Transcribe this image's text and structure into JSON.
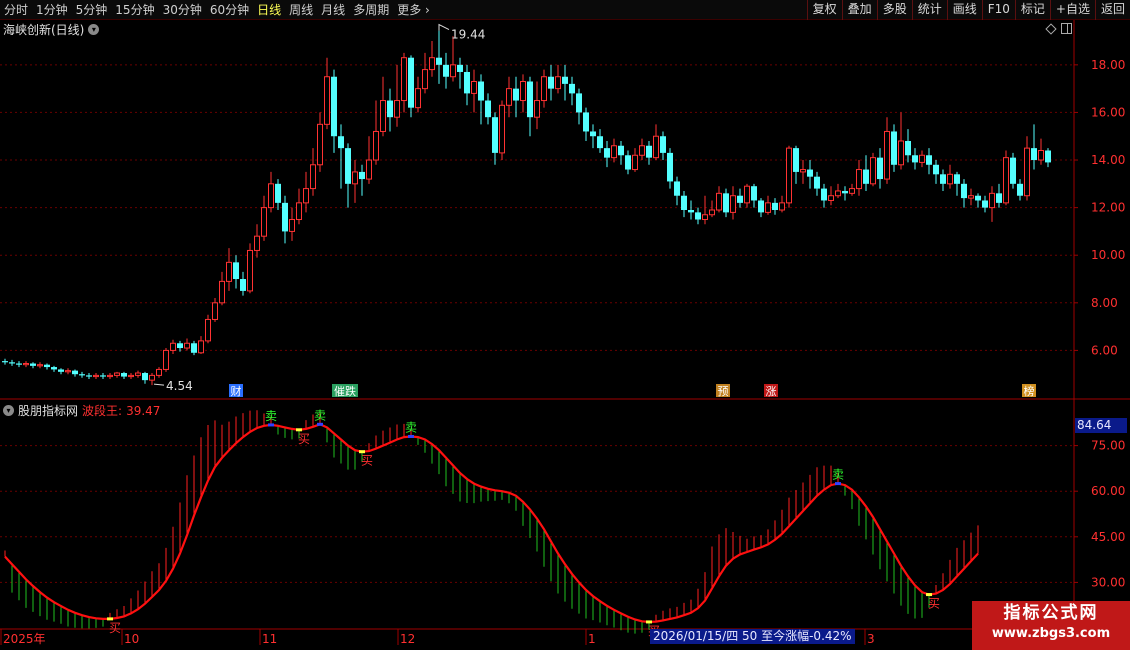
{
  "toolbar": {
    "periods": [
      "分时",
      "1分钟",
      "5分钟",
      "15分钟",
      "30分钟",
      "60分钟",
      "日线",
      "周线",
      "月线",
      "多周期",
      "更多"
    ],
    "active_period": "日线",
    "right_buttons": [
      "复权",
      "叠加",
      "多股",
      "统计",
      "画线",
      "F10",
      "标记",
      "+自选",
      "返回"
    ]
  },
  "chart_title": "海峡创新(日线)",
  "indicator": {
    "source": "股朋指标网",
    "name": "波段王:",
    "value": "39.47",
    "cursor_value": "84.64"
  },
  "price_axis": {
    "ticks": [
      "18.00",
      "16.00",
      "14.00",
      "12.00",
      "10.00",
      "8.00",
      "6.00"
    ]
  },
  "indicator_axis": {
    "ticks": [
      "75.00",
      "60.00",
      "45.00",
      "30.00"
    ]
  },
  "annotations": {
    "high": "19.44",
    "low": "4.54"
  },
  "event_tags": [
    "财",
    "催跌",
    "预",
    "涨",
    "榜"
  ],
  "signals": {
    "buy": "买",
    "sell": "卖"
  },
  "time_axis": [
    "2025年",
    "10",
    "11",
    "12",
    "1",
    "3"
  ],
  "status_date": "2026/01/15/四 50 至今涨幅-0.42%",
  "watermark": {
    "title": "指标公式网",
    "url": "www.zbgs3.com"
  },
  "colors": {
    "up_candle": "#ff3232",
    "down_candle": "#54ffff",
    "curve": "#ff1010",
    "hist_up": "#ff2020",
    "hist_down": "#20c020",
    "axis": "#a00000"
  },
  "chart_data": {
    "type": "candlestick",
    "price_range": [
      4.0,
      19.8
    ],
    "indicator_range": [
      15,
      90
    ],
    "candles": [
      [
        5.55,
        5.5,
        5.65,
        5.4
      ],
      [
        5.5,
        5.45,
        5.6,
        5.35
      ],
      [
        5.45,
        5.4,
        5.55,
        5.3
      ],
      [
        5.4,
        5.45,
        5.55,
        5.3
      ],
      [
        5.45,
        5.35,
        5.5,
        5.25
      ],
      [
        5.35,
        5.4,
        5.5,
        5.25
      ],
      [
        5.4,
        5.3,
        5.45,
        5.2
      ],
      [
        5.3,
        5.2,
        5.35,
        5.1
      ],
      [
        5.2,
        5.1,
        5.25,
        5.0
      ],
      [
        5.1,
        5.15,
        5.25,
        5.0
      ],
      [
        5.15,
        5.0,
        5.2,
        4.9
      ],
      [
        5.0,
        4.95,
        5.1,
        4.85
      ],
      [
        4.95,
        4.9,
        5.05,
        4.8
      ],
      [
        4.9,
        4.95,
        5.05,
        4.8
      ],
      [
        4.95,
        4.9,
        5.05,
        4.8
      ],
      [
        4.9,
        4.95,
        5.05,
        4.8
      ],
      [
        4.95,
        5.05,
        5.1,
        4.85
      ],
      [
        5.05,
        4.9,
        5.1,
        4.8
      ],
      [
        4.9,
        4.95,
        5.05,
        4.8
      ],
      [
        4.95,
        5.05,
        5.15,
        4.85
      ],
      [
        5.05,
        4.75,
        5.1,
        4.6
      ],
      [
        4.75,
        4.95,
        5.05,
        4.54
      ],
      [
        4.95,
        5.2,
        5.3,
        4.85
      ],
      [
        5.2,
        6.0,
        6.1,
        5.1
      ],
      [
        6.0,
        6.3,
        6.45,
        5.85
      ],
      [
        6.3,
        6.1,
        6.4,
        5.95
      ],
      [
        6.1,
        6.3,
        6.5,
        6.0
      ],
      [
        6.3,
        5.9,
        6.4,
        5.8
      ],
      [
        5.9,
        6.4,
        6.6,
        5.85
      ],
      [
        6.4,
        7.3,
        7.5,
        6.3
      ],
      [
        7.3,
        8.0,
        8.2,
        7.2
      ],
      [
        8.0,
        8.9,
        9.3,
        7.9
      ],
      [
        8.9,
        9.7,
        10.3,
        8.5
      ],
      [
        9.7,
        9.0,
        10.0,
        8.6
      ],
      [
        9.0,
        8.5,
        9.3,
        8.3
      ],
      [
        8.5,
        10.2,
        10.5,
        8.4
      ],
      [
        10.2,
        10.8,
        11.3,
        9.9
      ],
      [
        10.8,
        12.0,
        12.5,
        10.6
      ],
      [
        12.0,
        13.0,
        13.5,
        11.8
      ],
      [
        13.0,
        12.2,
        13.2,
        11.9
      ],
      [
        12.2,
        11.0,
        12.5,
        10.5
      ],
      [
        11.0,
        11.5,
        12.0,
        10.6
      ],
      [
        11.5,
        12.2,
        12.8,
        11.3
      ],
      [
        12.2,
        12.8,
        13.5,
        11.8
      ],
      [
        12.8,
        13.8,
        14.5,
        12.5
      ],
      [
        13.8,
        15.5,
        16.0,
        13.5
      ],
      [
        15.5,
        17.5,
        18.3,
        15.3
      ],
      [
        17.5,
        15.0,
        17.8,
        14.3
      ],
      [
        15.0,
        14.5,
        15.5,
        12.8
      ],
      [
        14.5,
        13.0,
        14.7,
        12.0
      ],
      [
        13.0,
        13.5,
        14.0,
        12.2
      ],
      [
        13.5,
        13.2,
        13.8,
        12.5
      ],
      [
        13.2,
        14.0,
        15.0,
        13.0
      ],
      [
        14.0,
        15.2,
        16.5,
        13.8
      ],
      [
        15.2,
        16.5,
        17.5,
        15.0
      ],
      [
        16.5,
        15.8,
        17.0,
        15.2
      ],
      [
        15.8,
        16.5,
        18.0,
        15.4
      ],
      [
        16.5,
        18.3,
        18.5,
        16.0
      ],
      [
        18.3,
        16.2,
        18.4,
        15.8
      ],
      [
        16.2,
        17.0,
        17.5,
        16.0
      ],
      [
        17.0,
        17.8,
        18.5,
        16.8
      ],
      [
        17.8,
        18.3,
        19.0,
        17.5
      ],
      [
        18.3,
        18.0,
        19.44,
        17.2
      ],
      [
        18.0,
        17.5,
        18.5,
        17.0
      ],
      [
        17.5,
        18.0,
        19.2,
        17.3
      ],
      [
        18.0,
        17.7,
        18.3,
        17.0
      ],
      [
        17.7,
        16.8,
        18.0,
        16.3
      ],
      [
        16.8,
        17.3,
        17.8,
        16.0
      ],
      [
        17.3,
        16.5,
        17.6,
        15.5
      ],
      [
        16.5,
        15.8,
        16.8,
        15.5
      ],
      [
        15.8,
        14.3,
        16.0,
        13.8
      ],
      [
        14.3,
        16.3,
        16.5,
        14.0
      ],
      [
        16.3,
        17.0,
        17.5,
        15.8
      ],
      [
        17.0,
        16.5,
        17.5,
        15.8
      ],
      [
        16.5,
        17.3,
        17.6,
        16.0
      ],
      [
        17.3,
        15.8,
        17.5,
        15.0
      ],
      [
        15.8,
        16.5,
        17.3,
        15.3
      ],
      [
        16.5,
        17.5,
        17.8,
        16.2
      ],
      [
        17.5,
        17.0,
        18.0,
        16.5
      ],
      [
        17.0,
        17.5,
        18.0,
        16.8
      ],
      [
        17.5,
        17.2,
        18.0,
        16.5
      ],
      [
        17.2,
        16.8,
        17.5,
        16.3
      ],
      [
        16.8,
        16.0,
        17.0,
        15.5
      ],
      [
        16.0,
        15.2,
        16.2,
        14.8
      ],
      [
        15.2,
        15.0,
        15.5,
        14.5
      ],
      [
        15.0,
        14.5,
        15.3,
        14.3
      ],
      [
        14.5,
        14.1,
        14.8,
        13.7
      ],
      [
        14.1,
        14.6,
        14.9,
        13.9
      ],
      [
        14.6,
        14.2,
        14.8,
        13.8
      ],
      [
        14.2,
        13.6,
        14.4,
        13.4
      ],
      [
        13.6,
        14.2,
        14.5,
        13.5
      ],
      [
        14.2,
        14.6,
        14.9,
        14.0
      ],
      [
        14.6,
        14.1,
        14.8,
        13.8
      ],
      [
        14.1,
        15.0,
        15.5,
        14.0
      ],
      [
        15.0,
        14.3,
        15.2,
        14.0
      ],
      [
        14.3,
        13.1,
        14.5,
        12.8
      ],
      [
        13.1,
        12.5,
        13.3,
        12.1
      ],
      [
        12.5,
        11.9,
        12.7,
        11.6
      ],
      [
        11.9,
        11.8,
        12.3,
        11.5
      ],
      [
        11.8,
        11.5,
        12.0,
        11.3
      ],
      [
        11.5,
        11.7,
        12.5,
        11.3
      ],
      [
        11.7,
        11.9,
        12.3,
        11.6
      ],
      [
        11.9,
        12.6,
        12.9,
        11.8
      ],
      [
        12.6,
        11.8,
        12.8,
        11.6
      ],
      [
        11.8,
        12.5,
        12.9,
        11.5
      ],
      [
        12.5,
        12.2,
        12.8,
        12.0
      ],
      [
        12.2,
        12.9,
        13.0,
        12.0
      ],
      [
        12.9,
        12.3,
        13.0,
        12.0
      ],
      [
        12.3,
        11.8,
        12.4,
        11.6
      ],
      [
        11.8,
        12.2,
        12.5,
        11.7
      ],
      [
        12.2,
        11.9,
        12.4,
        11.7
      ],
      [
        11.9,
        12.2,
        12.5,
        11.8
      ],
      [
        12.2,
        14.5,
        14.6,
        12.0
      ],
      [
        14.5,
        13.5,
        14.6,
        13.0
      ],
      [
        13.5,
        13.6,
        14.0,
        13.0
      ],
      [
        13.6,
        13.3,
        14.0,
        12.8
      ],
      [
        13.3,
        12.8,
        13.5,
        12.5
      ],
      [
        12.8,
        12.3,
        13.0,
        12.0
      ],
      [
        12.3,
        12.5,
        12.9,
        12.1
      ],
      [
        12.5,
        12.7,
        13.0,
        12.4
      ],
      [
        12.7,
        12.6,
        12.9,
        12.3
      ],
      [
        12.6,
        12.8,
        13.0,
        12.5
      ],
      [
        12.8,
        13.6,
        14.0,
        12.5
      ],
      [
        13.6,
        13.0,
        14.2,
        12.7
      ],
      [
        13.0,
        14.1,
        14.3,
        12.9
      ],
      [
        14.1,
        13.2,
        14.5,
        12.8
      ],
      [
        13.2,
        15.2,
        15.8,
        13.0
      ],
      [
        15.2,
        13.8,
        15.5,
        13.5
      ],
      [
        13.8,
        14.8,
        16.0,
        13.6
      ],
      [
        14.8,
        14.2,
        15.3,
        13.9
      ],
      [
        14.2,
        13.9,
        14.5,
        13.6
      ],
      [
        13.9,
        14.2,
        14.4,
        13.7
      ],
      [
        14.2,
        13.8,
        14.5,
        13.4
      ],
      [
        13.8,
        13.4,
        14.0,
        13.0
      ],
      [
        13.4,
        13.0,
        13.6,
        12.7
      ],
      [
        13.0,
        13.4,
        13.8,
        12.8
      ],
      [
        13.4,
        13.0,
        13.5,
        12.5
      ],
      [
        13.0,
        12.4,
        13.2,
        12.0
      ],
      [
        12.4,
        12.5,
        12.8,
        12.1
      ],
      [
        12.5,
        12.3,
        12.6,
        12.0
      ],
      [
        12.3,
        12.0,
        12.5,
        11.8
      ],
      [
        12.0,
        12.6,
        12.9,
        11.4
      ],
      [
        12.6,
        12.2,
        13.0,
        12.0
      ],
      [
        12.2,
        14.1,
        14.4,
        12.1
      ],
      [
        14.1,
        13.0,
        14.3,
        12.8
      ],
      [
        13.0,
        12.5,
        13.2,
        12.3
      ],
      [
        12.5,
        14.5,
        15.0,
        12.3
      ],
      [
        14.5,
        14.0,
        15.5,
        13.6
      ],
      [
        14.0,
        14.4,
        14.9,
        13.8
      ],
      [
        14.4,
        13.9,
        14.5,
        13.7
      ]
    ],
    "indicator": [
      38.5,
      36.0,
      33.5,
      31.0,
      28.8,
      26.8,
      25.0,
      23.5,
      22.2,
      21.0,
      20.0,
      19.2,
      18.6,
      18.2,
      18.0,
      18.0,
      18.3,
      18.8,
      19.8,
      21.2,
      23.0,
      25.2,
      27.5,
      30.5,
      34.5,
      39.5,
      45.5,
      52.0,
      58.0,
      63.5,
      68.0,
      71.0,
      73.5,
      75.8,
      77.8,
      79.5,
      80.8,
      81.5,
      81.8,
      81.5,
      81.0,
      80.5,
      80.2,
      80.5,
      81.2,
      82.0,
      81.0,
      79.0,
      77.0,
      75.0,
      73.5,
      73.0,
      73.2,
      74.0,
      75.0,
      76.0,
      77.0,
      77.8,
      78.0,
      77.8,
      77.0,
      75.5,
      73.5,
      71.0,
      68.5,
      66.0,
      64.0,
      62.5,
      61.5,
      60.8,
      60.3,
      60.0,
      59.5,
      58.5,
      56.5,
      54.0,
      51.0,
      47.5,
      43.5,
      39.5,
      36.0,
      32.8,
      30.0,
      27.5,
      25.5,
      23.8,
      22.3,
      21.0,
      19.8,
      18.7,
      17.8,
      17.2,
      17.0,
      17.1,
      17.5,
      18.0,
      18.5,
      19.2,
      20.0,
      21.5,
      24.0,
      28.0,
      32.0,
      35.5,
      37.8,
      39.2,
      40.0,
      40.8,
      41.5,
      42.5,
      44.0,
      46.0,
      48.5,
      51.0,
      53.5,
      56.0,
      58.5,
      60.5,
      62.0,
      62.5,
      62.0,
      60.5,
      58.0,
      55.0,
      51.5,
      47.5,
      43.5,
      39.5,
      35.5,
      32.0,
      29.0,
      26.8,
      26.0,
      26.3,
      27.5,
      29.5,
      32.0,
      34.5,
      37.0,
      39.47
    ]
  }
}
